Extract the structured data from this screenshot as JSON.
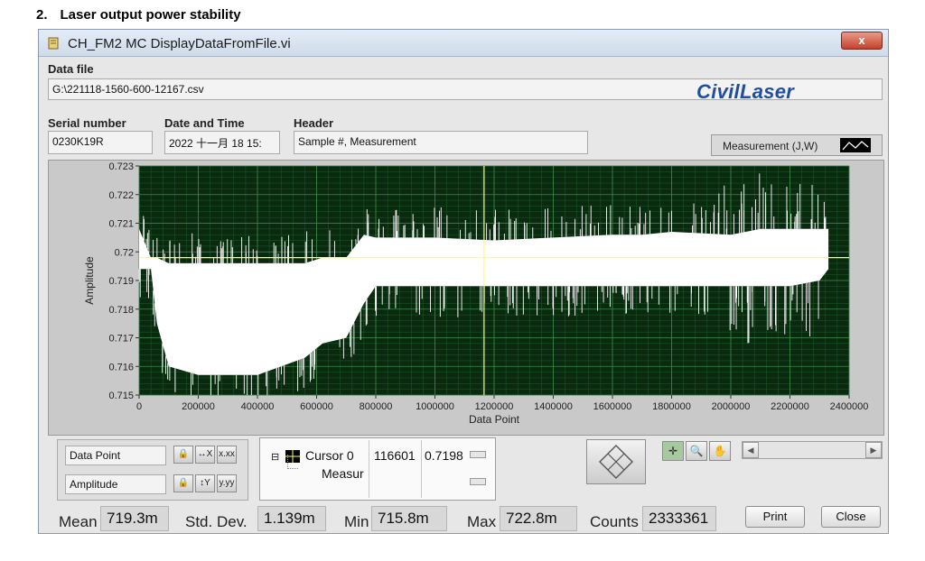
{
  "doc": {
    "number": "2.",
    "heading": "Laser output power stability"
  },
  "window": {
    "title": "CH_FM2 MC DisplayDataFromFile.vi",
    "close_label": "x"
  },
  "data_file": {
    "label": "Data file",
    "value": "G:\\221118-1560-600-12167.csv"
  },
  "logo": "CivilLaser",
  "serial": {
    "label": "Serial number",
    "value": "0230K19R"
  },
  "datetime": {
    "label": "Date and Time",
    "value": "2022 十一月 18 15:"
  },
  "header": {
    "label": "Header",
    "value": "Sample #, Measurement"
  },
  "legend": {
    "label": "Measurement (J,W)"
  },
  "chart_data": {
    "type": "line",
    "xlabel": "Data Point",
    "ylabel": "Amplitude",
    "xlim": [
      0,
      2400000
    ],
    "ylim": [
      0.715,
      0.723
    ],
    "x_ticks": [
      "0",
      "200000",
      "400000",
      "600000",
      "800000",
      "1000000",
      "1200000",
      "1400000",
      "1600000",
      "1800000",
      "2000000",
      "2200000",
      "2400000"
    ],
    "y_ticks": [
      "0.715",
      "0.716",
      "0.717",
      "0.718",
      "0.719",
      "0.72",
      "0.721",
      "0.722",
      "0.723"
    ],
    "grid": true,
    "background": "#0a2a10",
    "series_color": "#ffffff",
    "cursor_color": "#ffff66",
    "cursor": {
      "x": 1166000,
      "y": 0.7198
    },
    "envelope": {
      "x": [
        0,
        40000,
        60000,
        100000,
        200000,
        400000,
        560000,
        620000,
        700000,
        760000,
        800000,
        1000000,
        1200000,
        1600000,
        1700000,
        1800000,
        2000000,
        2100000,
        2200000,
        2300000,
        2330000
      ],
      "y_min": [
        0.7194,
        0.7194,
        0.7175,
        0.716,
        0.7157,
        0.7157,
        0.7163,
        0.7168,
        0.717,
        0.7182,
        0.7188,
        0.7188,
        0.7188,
        0.7188,
        0.7188,
        0.7188,
        0.7188,
        0.7188,
        0.7188,
        0.719,
        0.7194
      ],
      "y_max": [
        0.7208,
        0.7198,
        0.7198,
        0.7196,
        0.7196,
        0.7196,
        0.7196,
        0.7198,
        0.7198,
        0.7206,
        0.7205,
        0.7205,
        0.7204,
        0.7206,
        0.7206,
        0.7207,
        0.7206,
        0.7208,
        0.7208,
        0.7208,
        0.7208
      ]
    }
  },
  "axis_controls": {
    "x_name": "Data Point",
    "y_name": "Amplitude"
  },
  "cursor_panel": {
    "name": "Cursor 0",
    "x_value": "116601",
    "y_value": "0.7198",
    "plot_name": "Measur"
  },
  "stats": {
    "mean_label": "Mean",
    "mean_value": "719.3m",
    "std_label": "Std. Dev.",
    "std_value": "1.139m",
    "min_label": "Min",
    "min_value": "715.8m",
    "max_label": "Max",
    "max_value": "722.8m",
    "counts_label": "Counts",
    "counts_value": "2333361"
  },
  "buttons": {
    "print": "Print",
    "close": "Close"
  }
}
